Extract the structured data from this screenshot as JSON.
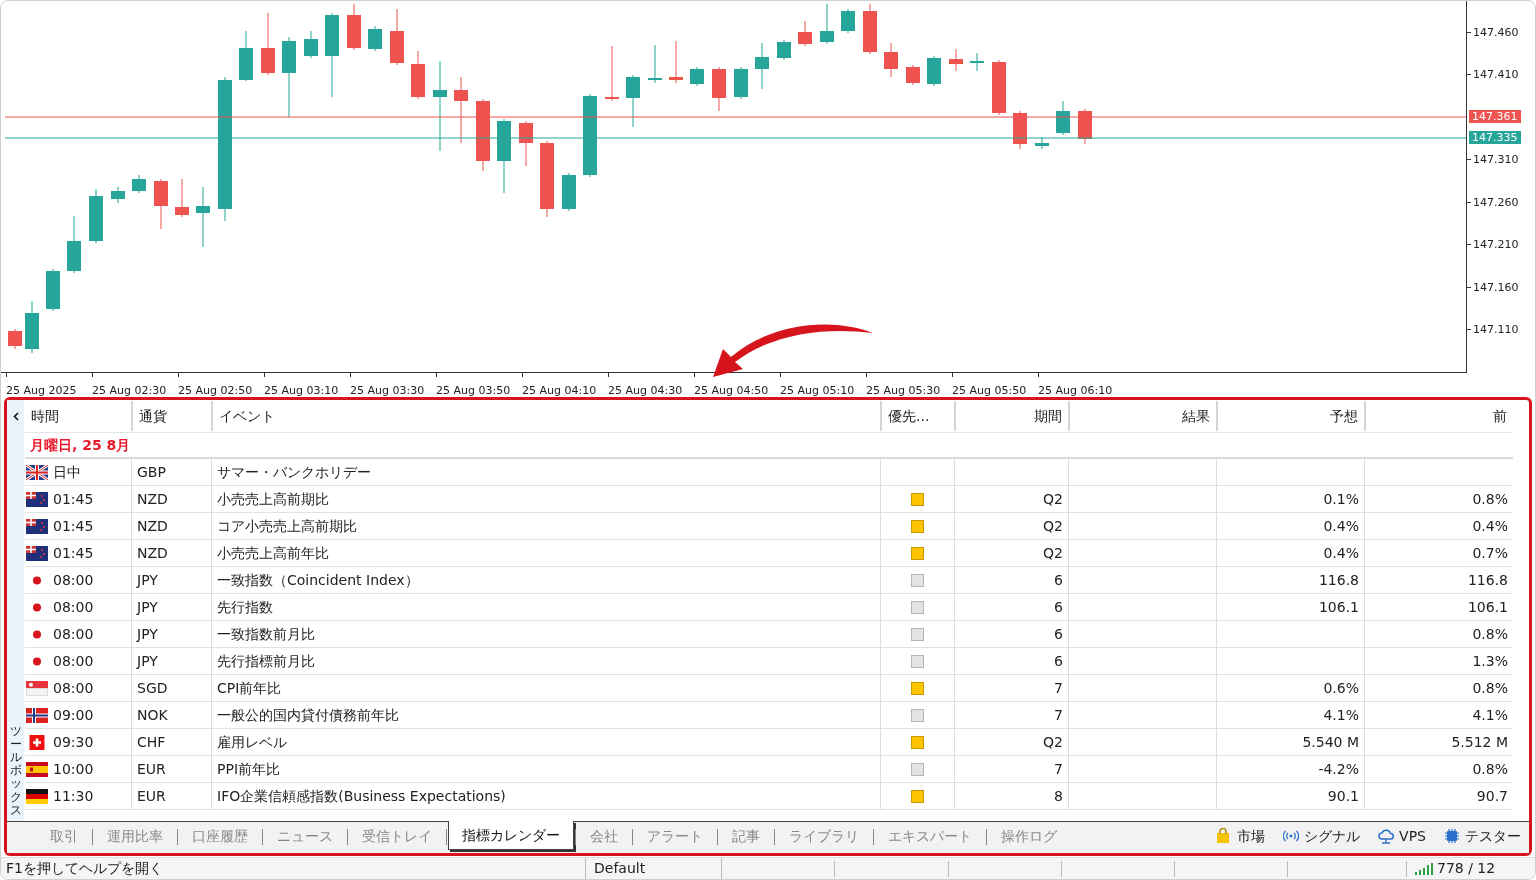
{
  "chart": {
    "price_axis": [
      "147.460",
      "147.410",
      "147.310",
      "147.260",
      "147.210",
      "147.160",
      "147.110"
    ],
    "price_tags": [
      {
        "kind": "bid",
        "label": "147.361"
      },
      {
        "kind": "ask",
        "label": "147.335"
      }
    ],
    "time_axis": [
      "25 Aug 2025",
      "25 Aug 02:30",
      "25 Aug 02:50",
      "25 Aug 03:10",
      "25 Aug 03:30",
      "25 Aug 03:50",
      "25 Aug 04:10",
      "25 Aug 04:30",
      "25 Aug 04:50",
      "25 Aug 05:10",
      "25 Aug 05:30",
      "25 Aug 05:50",
      "25 Aug 06:10"
    ]
  },
  "toolbox": {
    "title": "ツールボックス",
    "columns": [
      "時間",
      "通貨",
      "イベント",
      "優先...",
      "期間",
      "結果",
      "予想",
      "前"
    ],
    "date_header": "月曜日, 25 8月",
    "rows": [
      {
        "kind": "gb",
        "time": "日中",
        "currency": "GBP",
        "event": "サマー・バンクホリデー"
      },
      {
        "kind": "nz",
        "time": "01:45",
        "currency": "NZD",
        "event": "小売売上高前期比",
        "important": true,
        "period": "Q2",
        "forecast": "0.1%",
        "previous": "0.8%"
      },
      {
        "kind": "nz",
        "time": "01:45",
        "currency": "NZD",
        "event": "コア小売売上高前期比",
        "important": true,
        "period": "Q2",
        "forecast": "0.4%",
        "previous": "0.4%"
      },
      {
        "kind": "nz",
        "time": "01:45",
        "currency": "NZD",
        "event": "小売売上高前年比",
        "important": true,
        "period": "Q2",
        "forecast": "0.4%",
        "previous": "0.7%"
      },
      {
        "kind": "jp",
        "time": "08:00",
        "currency": "JPY",
        "event": "一致指数（Coincident Index）",
        "important": false,
        "period": "6",
        "forecast": "116.8",
        "previous": "116.8"
      },
      {
        "kind": "jp",
        "time": "08:00",
        "currency": "JPY",
        "event": "先行指数",
        "important": false,
        "period": "6",
        "forecast": "106.1",
        "previous": "106.1"
      },
      {
        "kind": "jp",
        "time": "08:00",
        "currency": "JPY",
        "event": "一致指数前月比",
        "important": false,
        "period": "6",
        "previous": "0.8%"
      },
      {
        "kind": "jp",
        "time": "08:00",
        "currency": "JPY",
        "event": "先行指標前月比",
        "important": false,
        "period": "6",
        "previous": "1.3%"
      },
      {
        "kind": "sg",
        "time": "08:00",
        "currency": "SGD",
        "event": "CPI前年比",
        "important": true,
        "period": "7",
        "forecast": "0.6%",
        "previous": "0.8%"
      },
      {
        "kind": "no",
        "time": "09:00",
        "currency": "NOK",
        "event": "一般公的国内貸付債務前年比",
        "important": false,
        "period": "7",
        "forecast": "4.1%",
        "previous": "4.1%"
      },
      {
        "kind": "ch",
        "time": "09:30",
        "currency": "CHF",
        "event": "雇用レベル",
        "important": true,
        "period": "Q2",
        "forecast": "5.540 M",
        "previous": "5.512 M"
      },
      {
        "kind": "es",
        "time": "10:00",
        "currency": "EUR",
        "event": "PPI前年比",
        "important": false,
        "period": "7",
        "forecast": "-4.2%",
        "previous": "0.8%"
      },
      {
        "kind": "de",
        "time": "11:30",
        "currency": "EUR",
        "event": "IFO企業信頼感指数(Business Expectations)",
        "important": true,
        "period": "8",
        "forecast": "90.1",
        "previous": "90.7"
      }
    ],
    "tabs": [
      {
        "label": "取引",
        "selected": false
      },
      {
        "label": "運用比率",
        "selected": false
      },
      {
        "label": "口座履歴",
        "selected": false
      },
      {
        "label": "ニュース",
        "selected": false
      },
      {
        "label": "受信トレイ",
        "selected": false
      },
      {
        "label": "指標カレンダー",
        "selected": true
      },
      {
        "label": "会社",
        "selected": false
      },
      {
        "label": "アラート",
        "selected": false
      },
      {
        "label": "記事",
        "selected": false
      },
      {
        "label": "ライブラリ",
        "selected": false
      },
      {
        "label": "エキスパート",
        "selected": false
      },
      {
        "label": "操作ログ",
        "selected": false
      }
    ],
    "services": [
      {
        "kind": "market",
        "label": "市場"
      },
      {
        "kind": "signal",
        "label": "シグナル"
      },
      {
        "kind": "vps",
        "label": "VPS"
      },
      {
        "kind": "tester",
        "label": "テスター"
      }
    ]
  },
  "status_bar": {
    "help": "F1を押してヘルプを開く",
    "profile": "Default",
    "connection": "778 / 12"
  }
}
